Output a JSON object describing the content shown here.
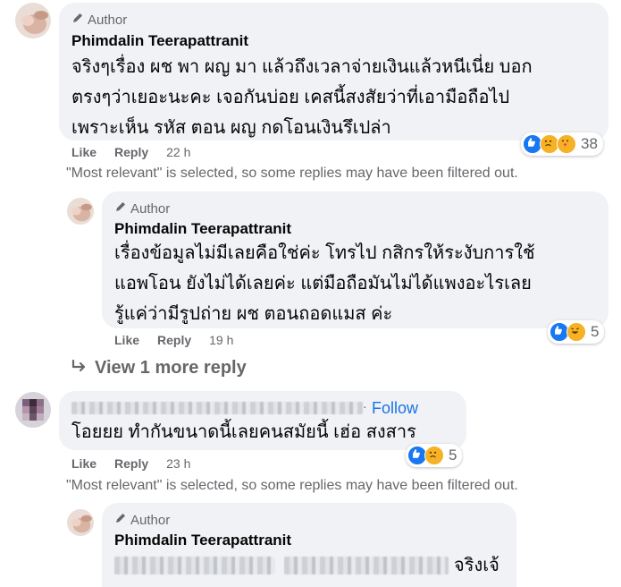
{
  "comments": [
    {
      "author_tag": "Author",
      "name": "Phimdalin Teerapattranit",
      "text": "จริงๆเรื่อง ผช พา ผญ มา แล้วถึงเวลาจ่ายเงินแล้วหนีเนี่ย บอก\nตรงๆว่าเยอะนะคะ เจอกันบ่อย เคสนี้สงสัยว่าที่เอามือถือไป\nเพราะเห็น รหัส ตอน ผญ กดโอนเงินรึเปล่า",
      "like": "Like",
      "reply": "Reply",
      "time": "22 h",
      "reaction_count": "38"
    },
    {
      "author_tag": "Author",
      "name": "Phimdalin Teerapattranit",
      "text": "เรื่องข้อมูลไม่มีเลยคือใช่ค่ะ โทรไป กสิกรให้ระงับการใช้\nแอพโอน ยังไม่ได้เลยค่ะ แต่มือถือมันไม่ได้แพงอะไรเลย\nรู้แค่ว่ามีรูปถ่าย ผช ตอนถอดแมส ค่ะ",
      "like": "Like",
      "reply": "Reply",
      "time": "19 h",
      "reaction_count": "5"
    },
    {
      "follow": "Follow",
      "text": "โอยยย ทำกันขนาดนี้เลยคนสมัยนี้ เฮ่อ สงสาร",
      "like": "Like",
      "reply": "Reply",
      "time": "23 h",
      "reaction_count": "5"
    },
    {
      "author_tag": "Author",
      "name": "Phimdalin Teerapattranit",
      "text_suffix": "จริงเจ้"
    }
  ],
  "filter_note": "\"Most relevant\" is selected, so some replies may have been filtered out.",
  "view_more": "View 1 more reply",
  "colors": {
    "like": "#1877f2",
    "haha": "#f7b125",
    "care": "#f7b125",
    "link": "#1b74e4"
  }
}
